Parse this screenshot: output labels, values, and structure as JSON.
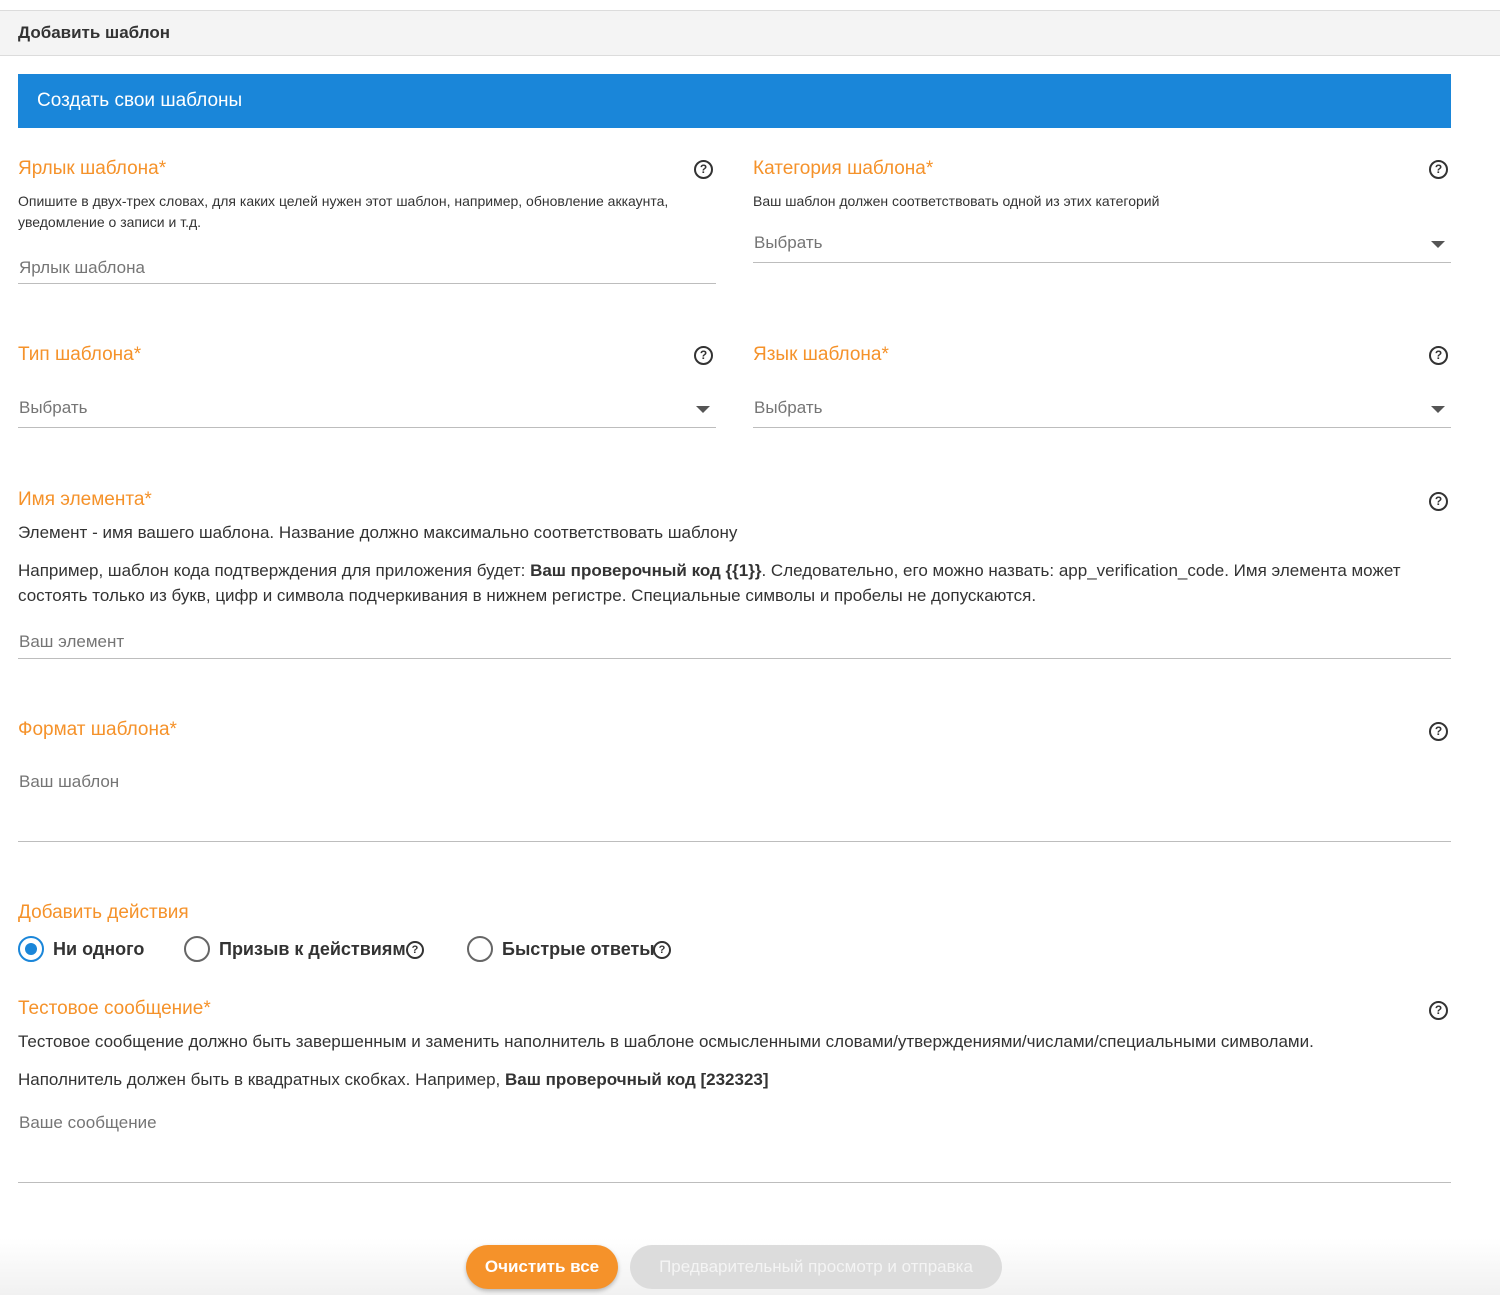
{
  "header": {
    "title": "Добавить шаблон"
  },
  "banner": {
    "title": "Создать свои шаблоны"
  },
  "help_glyph": "?",
  "template_label": {
    "label": "Ярлык шаблона*",
    "description": "Опишите в двух-трех словах, для каких целей нужен этот шаблон, например, обновление аккаунта, уведомление о записи и т.д.",
    "placeholder": "Ярлык шаблона"
  },
  "template_category": {
    "label": "Категория шаблона*",
    "description": "Ваш шаблон должен соответствовать одной из этих категорий",
    "selected": "Выбрать"
  },
  "template_type": {
    "label": "Тип шаблона*",
    "selected": "Выбрать"
  },
  "template_language": {
    "label": "Язык шаблона*",
    "selected": "Выбрать"
  },
  "element_name": {
    "label": "Имя элемента*",
    "description": "Элемент - имя вашего шаблона. Название должно максимально соответствовать шаблону",
    "example_prefix": "Например, шаблон кода подтверждения для приложения будет: ",
    "example_bold": "Ваш проверочный код {{1}}",
    "example_suffix": ". Следовательно, его можно назвать: app_verification_code. Имя элемента может состоять только из букв, цифр и символа подчеркивания в нижнем регистре. Специальные символы и пробелы не допускаются.",
    "placeholder": "Ваш элемент"
  },
  "template_format": {
    "label": "Формат шаблона*",
    "placeholder": "Ваш шаблон"
  },
  "actions": {
    "label": "Добавить действия",
    "options": [
      {
        "label": "Ни одного",
        "checked": true
      },
      {
        "label": "Призыв к действиям",
        "checked": false
      },
      {
        "label": "Быстрые ответы",
        "checked": false
      }
    ]
  },
  "test_message": {
    "label": "Тестовое сообщение*",
    "description": "Тестовое сообщение должно быть завершенным и заменить наполнитель в шаблоне осмысленными словами/утверждениями/числами/специальными символами.",
    "example_prefix": "Наполнитель должен быть в квадратных скобках. Например, ",
    "example_bold": "Ваш проверочный код [232323]",
    "placeholder": "Ваше сообщение"
  },
  "footer": {
    "clear_label": "Очистить все",
    "preview_label": "Предварительный просмотр и отправка"
  },
  "colors": {
    "accent_blue": "#1a86d9",
    "label_orange": "#f5922a",
    "disabled_gray": "#dcdcdc"
  }
}
